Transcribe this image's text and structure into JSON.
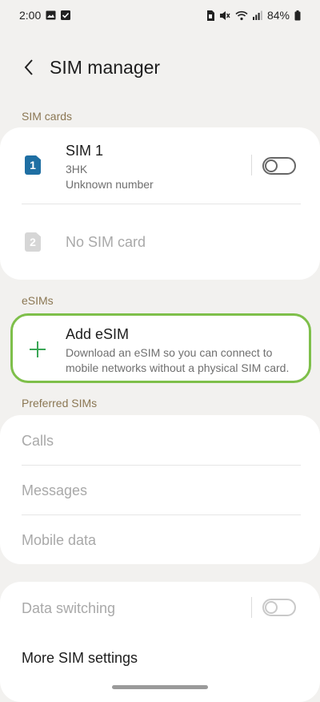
{
  "status_bar": {
    "time": "2:00",
    "battery": "84%",
    "left_icons": [
      "image-icon",
      "checkbox-icon"
    ],
    "right_icons": [
      "sim-icon",
      "mute-icon",
      "wifi-icon",
      "signal-icon",
      "battery-icon"
    ]
  },
  "header": {
    "title": "SIM manager",
    "back_icon": "back-chevron-icon"
  },
  "sim_cards": {
    "label": "SIM cards",
    "sim1": {
      "badge": "1",
      "name": "SIM 1",
      "carrier": "3HK",
      "number": "Unknown number",
      "enabled": false,
      "badge_color": "#1f6fa3"
    },
    "sim2": {
      "badge": "2",
      "name": "No SIM card"
    }
  },
  "esims": {
    "label": "eSIMs",
    "add": {
      "title": "Add eSIM",
      "description": "Download an eSIM so you can connect to mobile networks without a physical SIM card.",
      "icon": "plus-icon",
      "accent_color": "#3aa655",
      "highlight_color": "#7ebf4a"
    }
  },
  "preferred": {
    "label": "Preferred SIMs",
    "items": [
      "Calls",
      "Messages",
      "Mobile data"
    ]
  },
  "other": {
    "data_switching": "Data switching",
    "more_settings": "More SIM settings"
  }
}
